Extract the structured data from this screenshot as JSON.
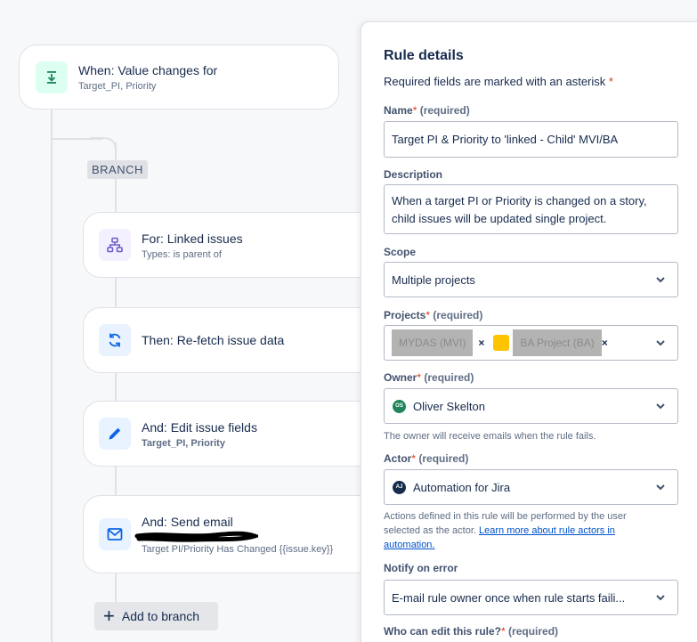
{
  "canvas": {
    "trigger": {
      "title": "When: Value changes for",
      "subtitle": "Target_PI, Priority"
    },
    "branch_label": "BRANCH",
    "cards": {
      "linked": {
        "title": "For: Linked issues",
        "subtitle": "Types: is parent of"
      },
      "refetch": {
        "title": "Then: Re-fetch issue data"
      },
      "edit": {
        "title": "And: Edit issue fields",
        "subtitle": "Target_PI, Priority"
      },
      "email": {
        "title": "And: Send email",
        "subtitle": "Target PI/Priority Has Changed {{issue.key}}"
      }
    },
    "add_branch_label": "Add to branch",
    "add_branch_plus": "+"
  },
  "panel": {
    "title": "Rule details",
    "hint": "Required fields are marked with an asterisk",
    "asterisk": "*",
    "name": {
      "label": "Name",
      "required": "(required)",
      "value": "Target PI & Priority to 'linked - Child' MVI/BA"
    },
    "description": {
      "label": "Description",
      "value_line1": "When a target PI or Priority is changed on a story,",
      "value_line2": "child issues will be updated single project."
    },
    "scope": {
      "label": "Scope",
      "value": "Multiple projects"
    },
    "projects": {
      "label": "Projects",
      "required": "(required)",
      "tags": [
        "MYDAS (MVI)",
        "BA Project (BA)"
      ],
      "remove": "×"
    },
    "owner": {
      "label": "Owner",
      "required": "(required)",
      "avatar": "OS",
      "value": "Oliver Skelton",
      "helper": "The owner will receive emails when the rule fails."
    },
    "actor": {
      "label": "Actor",
      "required": "(required)",
      "avatar": "AJ",
      "value": "Automation for Jira",
      "helper_line1": "Actions defined in this rule will be performed by the user",
      "helper_line2": "selected as the actor.",
      "helper_link1": "Learn more about rule actors in",
      "helper_link2": "automation."
    },
    "notify": {
      "label": "Notify on error",
      "value": "E-mail rule owner once when rule starts faili..."
    },
    "who_edit": {
      "label": "Who can edit this rule?",
      "required": "(required)"
    }
  },
  "colors": {
    "trigger_icon_bg": "#dcfff1",
    "trigger_icon": "#1f845a",
    "branch_icon_bg": "#f3f0ff",
    "branch_icon": "#6e5dc6",
    "action_icon_bg": "#e9f2ff",
    "action_icon": "#0c66e4",
    "owner_avatar": "#1f845a",
    "actor_avatar": "#172b4d",
    "required": "#de350b",
    "link": "#0052cc"
  },
  "icons": {
    "trigger": "download-arrow-icon",
    "linked": "hierarchy-icon",
    "refetch": "refresh-icon",
    "edit": "pencil-icon",
    "email": "envelope-icon",
    "dropdown": "chevron-down-icon"
  }
}
